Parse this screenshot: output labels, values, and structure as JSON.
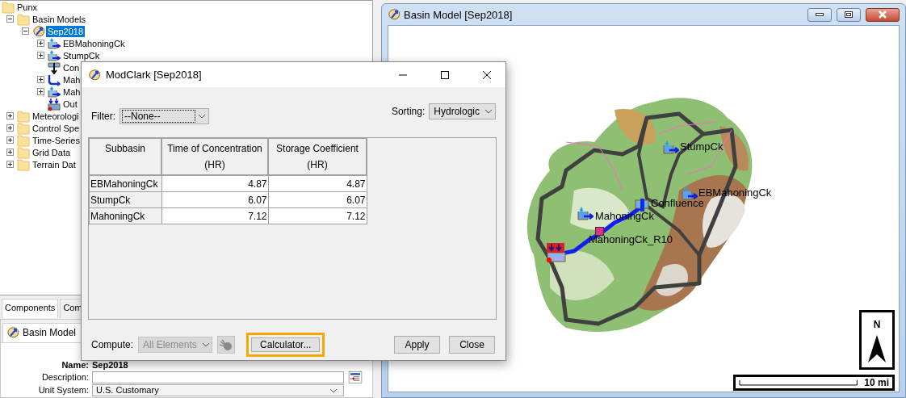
{
  "tree": {
    "items": [
      {
        "kind": "folder",
        "label": "Punx",
        "selected": false,
        "children": [
          {
            "kind": "folder",
            "label": "Basin Models",
            "expanded": true,
            "selected": false,
            "children": [
              {
                "kind": "basin",
                "label": "Sep2018",
                "expanded": true,
                "selected": true,
                "children": [
                  {
                    "kind": "subbasin",
                    "label": "EBMahoningCk",
                    "expanded": false,
                    "selected": false
                  },
                  {
                    "kind": "subbasin",
                    "label": "StumpCk",
                    "expanded": false,
                    "selected": false
                  },
                  {
                    "kind": "junction",
                    "label": "Con",
                    "selected": false
                  },
                  {
                    "kind": "reach",
                    "label": "Mah",
                    "expanded": false,
                    "selected": false
                  },
                  {
                    "kind": "subbasin",
                    "label": "Mah",
                    "expanded": false,
                    "selected": false
                  },
                  {
                    "kind": "sink",
                    "label": "Out",
                    "selected": false
                  }
                ]
              }
            ]
          },
          {
            "kind": "folder",
            "label": "Meteorologi",
            "expanded": false,
            "selected": false
          },
          {
            "kind": "folder",
            "label": "Control Spe",
            "expanded": false,
            "selected": false
          },
          {
            "kind": "folder",
            "label": "Time-Series",
            "expanded": false,
            "selected": false
          },
          {
            "kind": "folder",
            "label": "Grid Data",
            "expanded": false,
            "selected": false
          },
          {
            "kind": "folder",
            "label": "Terrain Dat",
            "expanded": false,
            "selected": false
          }
        ]
      }
    ]
  },
  "left_tabs": [
    {
      "label": "Components",
      "selected": true
    },
    {
      "label": "Com",
      "selected": false
    }
  ],
  "editor": {
    "tab": "Basin Model",
    "name_label": "Name:",
    "name_value": "Sep2018",
    "description_label": "Description:",
    "unit_label": "Unit System:",
    "unit_value": "U.S. Customary"
  },
  "basin_window": {
    "title": "Basin Model [Sep2018]",
    "north": "N",
    "scale": "10 mi",
    "elements": [
      {
        "kind": "subbasin",
        "label": "StumpCk"
      },
      {
        "kind": "subbasin",
        "label": "EBMahoningCk"
      },
      {
        "kind": "junction",
        "label": "Confluence"
      },
      {
        "kind": "subbasin",
        "label": "MahoningCk"
      },
      {
        "kind": "reach",
        "label": "MahoningCk_R10"
      },
      {
        "kind": "sink"
      }
    ]
  },
  "dialog": {
    "title": "ModClark [Sep2018]",
    "filter": {
      "label": "Filter:",
      "value": "--None--",
      "focused": true
    },
    "sorting": {
      "label": "Sorting:",
      "value": "Hydrologic"
    },
    "table": {
      "columns": [
        "Subbasin",
        "Time of Concentration\n(HR)",
        "Storage Coefficient\n(HR)"
      ],
      "rows": [
        [
          "EBMahoningCk",
          "4.87",
          "4.87"
        ],
        [
          "StumpCk",
          "6.07",
          "6.07"
        ],
        [
          "MahoningCk",
          "7.12",
          "7.12"
        ]
      ]
    },
    "compute": {
      "label": "Compute:",
      "value": "All Elements",
      "disabled": true
    },
    "calculator": {
      "label": "Calculator...",
      "highlighted": true
    },
    "buttons": [
      "Apply",
      "Close"
    ]
  }
}
